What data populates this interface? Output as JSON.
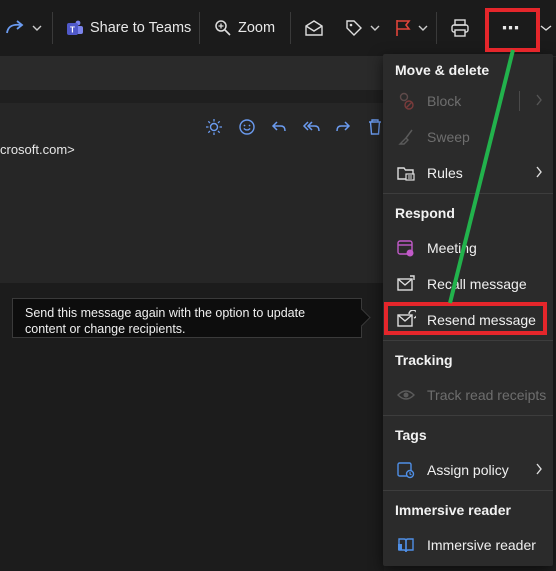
{
  "toolbar": {
    "share_label": "Share to Teams",
    "zoom_label": "Zoom",
    "more_label": "⋯"
  },
  "email": {
    "address_fragment": "crosoft.com>"
  },
  "tooltip": {
    "text": "Send this message again with the option to update content or change recipients."
  },
  "menu": {
    "sections": {
      "move": "Move & delete",
      "respond": "Respond",
      "tracking": "Tracking",
      "tags": "Tags",
      "immersive": "Immersive reader"
    },
    "items": {
      "block": "Block",
      "sweep": "Sweep",
      "rules": "Rules",
      "meeting": "Meeting",
      "recall": "Recall message",
      "resend": "Resend message",
      "track": "Track read receipts",
      "assign": "Assign policy",
      "reader": "Immersive reader"
    }
  },
  "colors": {
    "accent": "#6b9bf0",
    "flag": "#e0443a",
    "annotation": "#e5262b",
    "arrow": "#22b24c"
  }
}
